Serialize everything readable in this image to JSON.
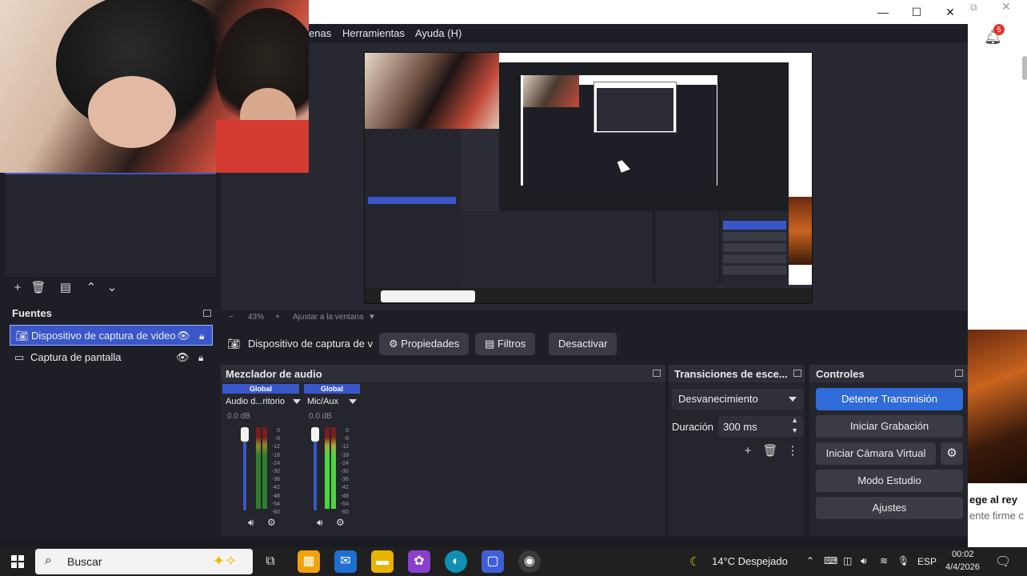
{
  "window": {
    "menu": [
      "enas",
      "Herramientas",
      "Ayuda (H)"
    ],
    "controls": {
      "minimize": "—",
      "maximize": "☐",
      "close": "✕"
    }
  },
  "preview": {
    "zoom_label": "43%",
    "fit_label": "Ajustar a la ventana"
  },
  "toolbar": {
    "source_name": "Dispositivo de captura de v",
    "properties": "Propiedades",
    "filters": "Filtros",
    "deactivate": "Desactivar"
  },
  "sources": {
    "title": "Fuentes",
    "items": [
      {
        "label": "Dispositivo de captura de video",
        "icon": "camera-icon",
        "selected": true
      },
      {
        "label": "Captura de pantalla",
        "icon": "monitor-icon",
        "selected": false
      }
    ]
  },
  "mixer": {
    "title": "Mezclador de audio",
    "channels": [
      {
        "tag": "Global",
        "name": "Audio d...ritorio",
        "db": "0.0 dB",
        "level": 0.0
      },
      {
        "tag": "Global",
        "name": "Mic/Aux",
        "db": "0.0 dB",
        "level": 0.85
      }
    ],
    "scale": [
      "0",
      "-6",
      "-12",
      "-18",
      "-24",
      "-30",
      "-36",
      "-42",
      "-48",
      "-54",
      "-60"
    ]
  },
  "transitions": {
    "title": "Transiciones de esce...",
    "selected": "Desvanecimiento",
    "duration_label": "Duración",
    "duration_value": "300 ms"
  },
  "controls": {
    "title": "Controles",
    "stop_stream": "Detener Transmisión",
    "start_recording": "Iniciar Grabación",
    "start_virtual_cam": "Iniciar Cámara Virtual",
    "studio_mode": "Modo Estudio",
    "settings": "Ajustes"
  },
  "background_page": {
    "notification_count": "5",
    "title_fragment": "ege al rey",
    "subtitle_fragment": "ente firme c"
  },
  "taskbar": {
    "search_placeholder": "Buscar",
    "weather": "14°C  Despejado",
    "language": "ESP",
    "time": "00:02",
    "date": "4/4/2026"
  }
}
